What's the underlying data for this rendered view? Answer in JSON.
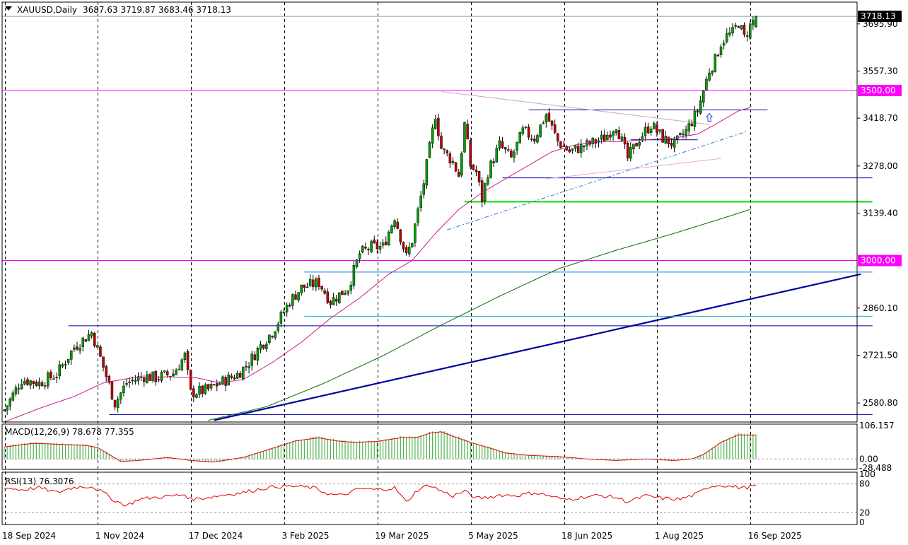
{
  "header": {
    "symbol": "XAUUSD,Daily",
    "ohlc": "3687.63 3719.87 3683.46 3718.13"
  },
  "colors": {
    "bull": "#00a000",
    "bear": "#c00000",
    "ma_fast": "#c0208c",
    "ma_slow": "#007000",
    "magenta": "#ff00ff",
    "navy": "#0000a0",
    "lime": "#00dd00",
    "macd_hist": "#50b050",
    "macd_signal": "#e00000",
    "rsi_line": "#e00000"
  },
  "chart_data": {
    "type": "candlestick",
    "price_axis_ticks": [
      "3695.90",
      "3557.30",
      "3418.70",
      "3278.00",
      "3139.40",
      "2860.10",
      "2721.50",
      "2580.80"
    ],
    "price_levels": [
      {
        "label": "3718.13",
        "value": 3718.13,
        "kind": "current"
      },
      {
        "label": "3500.00",
        "value": 3500.0,
        "kind": "magenta"
      },
      {
        "label": "3000.00",
        "value": 3000.0,
        "kind": "magenta"
      }
    ],
    "ylim": [
      2525,
      3760
    ],
    "date_labels": [
      "18 Sep 2024",
      "1 Nov 2024",
      "17 Dec 2024",
      "3 Feb 2025",
      "19 Mar 2025",
      "5 May 2025",
      "18 Jun 2025",
      "1 Aug 2025",
      "16 Sep 2025"
    ],
    "date_label_index": [
      0,
      32,
      64,
      96,
      128,
      160,
      192,
      224,
      256
    ],
    "bar_count": 259,
    "price_path": [
      [
        0,
        2560
      ],
      [
        6,
        2650
      ],
      [
        12,
        2640
      ],
      [
        18,
        2665
      ],
      [
        24,
        2745
      ],
      [
        30,
        2788
      ],
      [
        32,
        2740
      ],
      [
        38,
        2580
      ],
      [
        42,
        2640
      ],
      [
        48,
        2660
      ],
      [
        52,
        2655
      ],
      [
        58,
        2668
      ],
      [
        62,
        2720
      ],
      [
        64,
        2610
      ],
      [
        70,
        2620
      ],
      [
        74,
        2640
      ],
      [
        80,
        2665
      ],
      [
        84,
        2700
      ],
      [
        88,
        2750
      ],
      [
        92,
        2790
      ],
      [
        98,
        2880
      ],
      [
        102,
        2920
      ],
      [
        108,
        2935
      ],
      [
        112,
        2880
      ],
      [
        118,
        2920
      ],
      [
        122,
        3020
      ],
      [
        126,
        3040
      ],
      [
        130,
        3040
      ],
      [
        134,
        3130
      ],
      [
        138,
        3010
      ],
      [
        140,
        3060
      ],
      [
        144,
        3230
      ],
      [
        147,
        3380
      ],
      [
        148,
        3430
      ],
      [
        150,
        3330
      ],
      [
        154,
        3290
      ],
      [
        156,
        3250
      ],
      [
        158,
        3400
      ],
      [
        160,
        3280
      ],
      [
        162,
        3260
      ],
      [
        164,
        3180
      ],
      [
        166,
        3260
      ],
      [
        170,
        3340
      ],
      [
        174,
        3300
      ],
      [
        178,
        3380
      ],
      [
        182,
        3360
      ],
      [
        186,
        3430
      ],
      [
        190,
        3350
      ],
      [
        194,
        3320
      ],
      [
        200,
        3340
      ],
      [
        206,
        3360
      ],
      [
        210,
        3400
      ],
      [
        214,
        3300
      ],
      [
        218,
        3360
      ],
      [
        222,
        3400
      ],
      [
        226,
        3360
      ],
      [
        230,
        3340
      ],
      [
        234,
        3380
      ],
      [
        238,
        3440
      ],
      [
        240,
        3500
      ],
      [
        242,
        3560
      ],
      [
        244,
        3590
      ],
      [
        246,
        3640
      ],
      [
        248,
        3660
      ],
      [
        250,
        3670
      ],
      [
        252,
        3700
      ],
      [
        254,
        3655
      ],
      [
        256,
        3690
      ],
      [
        258,
        3718
      ]
    ],
    "ma_fast": [
      [
        0,
        2525
      ],
      [
        12,
        2565
      ],
      [
        24,
        2600
      ],
      [
        34,
        2640
      ],
      [
        44,
        2655
      ],
      [
        56,
        2658
      ],
      [
        66,
        2655
      ],
      [
        74,
        2640
      ],
      [
        82,
        2650
      ],
      [
        92,
        2700
      ],
      [
        102,
        2760
      ],
      [
        112,
        2830
      ],
      [
        122,
        2890
      ],
      [
        132,
        2960
      ],
      [
        140,
        3000
      ],
      [
        148,
        3080
      ],
      [
        156,
        3150
      ],
      [
        164,
        3200
      ],
      [
        172,
        3240
      ],
      [
        180,
        3280
      ],
      [
        188,
        3320
      ],
      [
        196,
        3340
      ],
      [
        204,
        3350
      ],
      [
        212,
        3350
      ],
      [
        220,
        3355
      ],
      [
        230,
        3360
      ],
      [
        238,
        3372
      ],
      [
        244,
        3400
      ],
      [
        252,
        3440
      ],
      [
        256,
        3450
      ]
    ],
    "ma_slow": [
      [
        70,
        2530
      ],
      [
        90,
        2570
      ],
      [
        110,
        2640
      ],
      [
        130,
        2720
      ],
      [
        150,
        2810
      ],
      [
        170,
        2895
      ],
      [
        190,
        2975
      ],
      [
        210,
        3030
      ],
      [
        230,
        3080
      ],
      [
        245,
        3120
      ],
      [
        256,
        3150
      ]
    ],
    "trendlines": [
      {
        "style": "thick",
        "color": "navy",
        "from": [
          72,
          2530
        ],
        "to": [
          294,
          2960
        ]
      },
      {
        "style": "thin",
        "color": "navy",
        "from": [
          36,
          2547
        ],
        "to": [
          298,
          2547
        ]
      },
      {
        "style": "thin",
        "color": "navy",
        "from": [
          22,
          2808
        ],
        "to": [
          298,
          2808
        ]
      },
      {
        "style": "thin",
        "color": "teal",
        "from": [
          103,
          2836
        ],
        "to": [
          298,
          2836
        ]
      },
      {
        "style": "thin",
        "color": "dodgerblue",
        "from": [
          103,
          2966
        ],
        "to": [
          298,
          2966
        ]
      },
      {
        "style": "medium",
        "color": "lime",
        "from": [
          158,
          3173
        ],
        "to": [
          298,
          3173
        ]
      },
      {
        "style": "thin",
        "color": "navy",
        "from": [
          171,
          3243
        ],
        "to": [
          298,
          3243
        ]
      },
      {
        "style": "thin",
        "color": "navy",
        "from": [
          180,
          3443
        ],
        "to": [
          262,
          3443
        ]
      },
      {
        "style": "dashdot",
        "color": "steelblue",
        "from": [
          152,
          3090
        ],
        "to": [
          255,
          3380
        ]
      },
      {
        "style": "thin",
        "color": "plum",
        "from": [
          150,
          3497
        ],
        "to": [
          242,
          3400
        ]
      },
      {
        "style": "thin",
        "color": "pink",
        "from": [
          186,
          3240
        ],
        "to": [
          246,
          3300
        ]
      },
      {
        "style": "thin",
        "color": "navy",
        "from": [
          215,
          3355
        ],
        "to": [
          238,
          3355
        ]
      }
    ],
    "macd": {
      "label": "MACD(12,26,9) 78.678 77.355",
      "ticks": [
        "106.157",
        "0.00",
        "-28.488"
      ],
      "range": [
        -28.488,
        106.157
      ],
      "path": [
        [
          0,
          40
        ],
        [
          10,
          52
        ],
        [
          20,
          48
        ],
        [
          28,
          45
        ],
        [
          32,
          38
        ],
        [
          36,
          15
        ],
        [
          40,
          -8
        ],
        [
          46,
          -5
        ],
        [
          56,
          5
        ],
        [
          64,
          -5
        ],
        [
          72,
          -10
        ],
        [
          82,
          5
        ],
        [
          92,
          35
        ],
        [
          100,
          60
        ],
        [
          108,
          70
        ],
        [
          114,
          60
        ],
        [
          120,
          55
        ],
        [
          128,
          58
        ],
        [
          136,
          70
        ],
        [
          142,
          72
        ],
        [
          146,
          85
        ],
        [
          150,
          90
        ],
        [
          154,
          75
        ],
        [
          160,
          55
        ],
        [
          166,
          38
        ],
        [
          172,
          20
        ],
        [
          180,
          12
        ],
        [
          190,
          8
        ],
        [
          200,
          0
        ],
        [
          210,
          -5
        ],
        [
          220,
          0
        ],
        [
          230,
          -5
        ],
        [
          236,
          0
        ],
        [
          240,
          15
        ],
        [
          246,
          55
        ],
        [
          252,
          80
        ],
        [
          258,
          78
        ]
      ]
    },
    "rsi": {
      "label": "RSI(13) 76.3076",
      "ticks": [
        "100",
        "80",
        "20",
        "0"
      ],
      "range": [
        0,
        100
      ],
      "path": [
        [
          0,
          72
        ],
        [
          6,
          68
        ],
        [
          12,
          72
        ],
        [
          18,
          62
        ],
        [
          24,
          73
        ],
        [
          30,
          75
        ],
        [
          34,
          62
        ],
        [
          38,
          45
        ],
        [
          42,
          35
        ],
        [
          46,
          48
        ],
        [
          52,
          52
        ],
        [
          58,
          55
        ],
        [
          62,
          58
        ],
        [
          64,
          48
        ],
        [
          70,
          52
        ],
        [
          76,
          58
        ],
        [
          82,
          62
        ],
        [
          88,
          70
        ],
        [
          94,
          75
        ],
        [
          100,
          75
        ],
        [
          106,
          72
        ],
        [
          112,
          58
        ],
        [
          116,
          56
        ],
        [
          122,
          70
        ],
        [
          128,
          68
        ],
        [
          134,
          72
        ],
        [
          138,
          42
        ],
        [
          142,
          68
        ],
        [
          146,
          78
        ],
        [
          150,
          65
        ],
        [
          154,
          55
        ],
        [
          158,
          65
        ],
        [
          162,
          50
        ],
        [
          166,
          52
        ],
        [
          170,
          57
        ],
        [
          176,
          56
        ],
        [
          182,
          62
        ],
        [
          188,
          54
        ],
        [
          192,
          47
        ],
        [
          198,
          52
        ],
        [
          204,
          56
        ],
        [
          210,
          52
        ],
        [
          214,
          43
        ],
        [
          220,
          55
        ],
        [
          226,
          50
        ],
        [
          232,
          48
        ],
        [
          238,
          60
        ],
        [
          242,
          75
        ],
        [
          246,
          78
        ],
        [
          250,
          74
        ],
        [
          254,
          72
        ],
        [
          258,
          76
        ]
      ]
    }
  }
}
